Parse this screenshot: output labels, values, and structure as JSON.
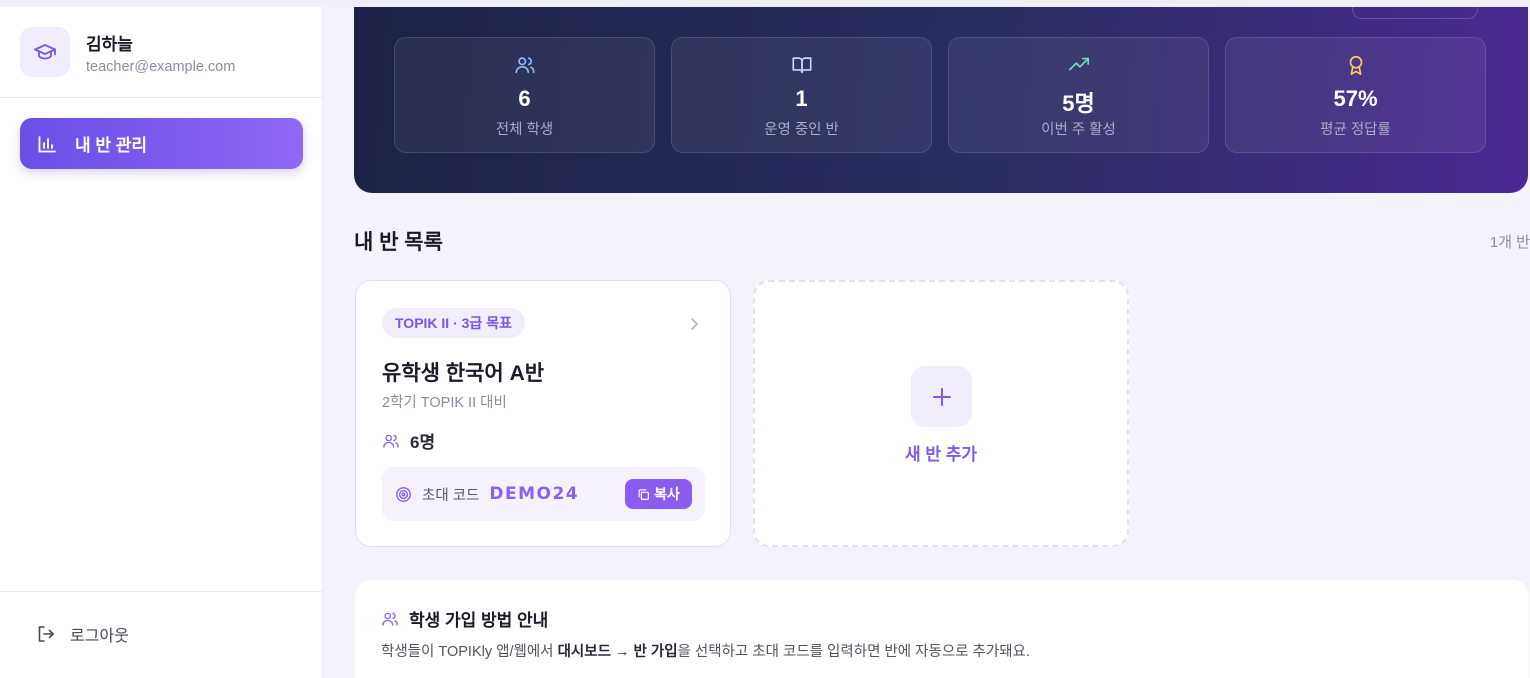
{
  "sidebar": {
    "profile": {
      "name": "김하늘",
      "email": "teacher@example.com",
      "avatar_icon": "graduation-cap-icon"
    },
    "nav": [
      {
        "label": "내 반 관리",
        "icon": "bar-chart-icon",
        "active": true
      }
    ],
    "logout": {
      "label": "로그아웃",
      "icon": "logout-icon"
    }
  },
  "stats": [
    {
      "value": "6",
      "caption": "전체 학생",
      "icon": "users-icon",
      "color": "#8fb8ff"
    },
    {
      "value": "1",
      "caption": "운영 중인 반",
      "icon": "book-icon",
      "color": "#c9d6ff"
    },
    {
      "value": "5명",
      "caption": "이번 주 활성",
      "icon": "trending-up-icon",
      "color": "#6fe0b0"
    },
    {
      "value": "57%",
      "caption": "평균 정답률",
      "icon": "award-icon",
      "color": "#ffcc5c"
    }
  ],
  "class_list": {
    "title": "내 반 목록",
    "count": "1개 반"
  },
  "class_card": {
    "tag": "TOPIK II · 3급 목표",
    "name": "유학생 한국어 A반",
    "subtitle": "2학기 TOPIK II 대비",
    "students": "6명",
    "invite_label": "초대 코드",
    "invite_code": "DEMO24",
    "copy_label": "복사"
  },
  "add_card": {
    "label": "새 반 추가"
  },
  "guide": {
    "title": "학생 가입 방법 안내",
    "text_prefix": "학생들이 TOPIKly 앱/웹에서 ",
    "text_bold": "대시보드 → 반 가입",
    "text_suffix": "을 선택하고 초대 코드를 입력하면 반에 자동으로 추가돼요."
  },
  "colors": {
    "accent": "#7a55e6",
    "hero_start": "#1d2248",
    "hero_end": "#4a2992"
  }
}
